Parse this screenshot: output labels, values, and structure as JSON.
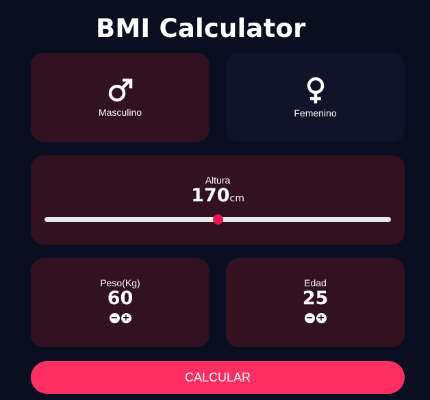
{
  "app": {
    "title": "BMI Calculator"
  },
  "gender": {
    "male_label": "Masculino",
    "female_label": "Femenino",
    "selected": "male",
    "male_icon": "male-symbol-icon",
    "female_icon": "female-symbol-icon"
  },
  "height": {
    "label": "Altura",
    "value": "170",
    "unit": "cm",
    "slider_fraction": 0.5
  },
  "weight": {
    "label": "Peso(Kg)",
    "value": "60",
    "minus": "−",
    "plus": "+"
  },
  "age": {
    "label": "Edad",
    "value": "25",
    "minus": "−",
    "plus": "+"
  },
  "action": {
    "calculate_label": "CALCULAR"
  },
  "colors": {
    "background": "#090e21",
    "active_card": "#321120",
    "inactive_card": "#111328",
    "accent": "#ff2f63"
  }
}
